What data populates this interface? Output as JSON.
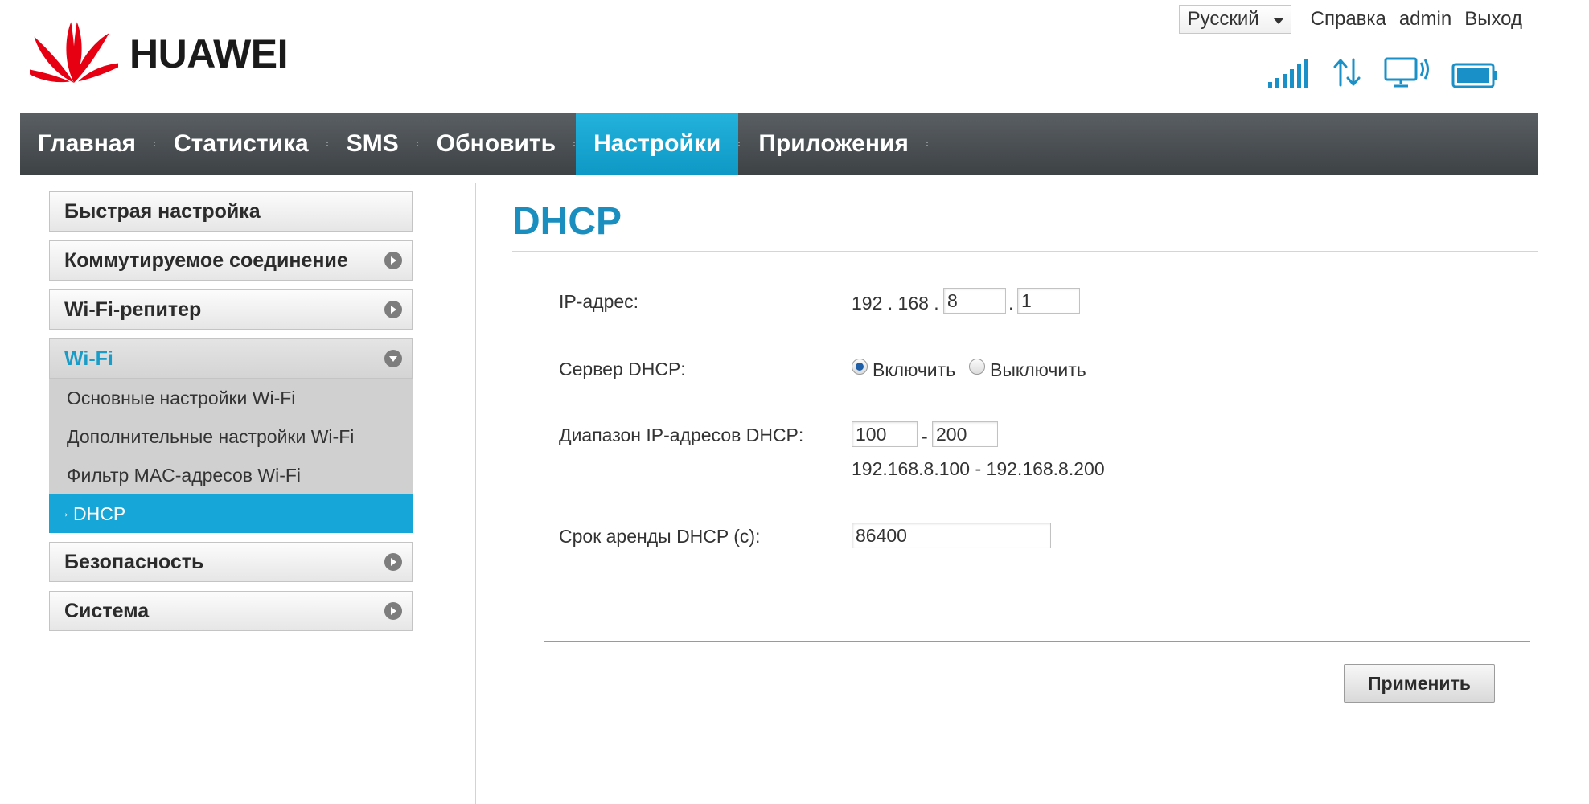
{
  "brand": {
    "name": "HUAWEI",
    "logo_color": "#e60012"
  },
  "header": {
    "language": "Русский",
    "help": "Справка",
    "user": "admin",
    "logout": "Выход",
    "status_icons": [
      "signal-strength-icon",
      "data-transfer-icon",
      "connected-device-icon",
      "battery-icon"
    ],
    "icon_color": "#1a90c8"
  },
  "nav": {
    "active_color": "#17a6d8",
    "items": [
      {
        "label": "Главная"
      },
      {
        "label": "Статистика"
      },
      {
        "label": "SMS"
      },
      {
        "label": "Обновить"
      },
      {
        "label": "Настройки",
        "active": true
      },
      {
        "label": "Приложения"
      }
    ]
  },
  "sidebar": {
    "items": [
      {
        "label": "Быстрая настройка"
      },
      {
        "label": "Коммутируемое соединение"
      },
      {
        "label": "Wi-Fi-репитер"
      },
      {
        "label": "Wi-Fi",
        "open": true,
        "children": [
          {
            "label": "Основные настройки Wi-Fi"
          },
          {
            "label": "Дополнительные настройки Wi-Fi"
          },
          {
            "label": "Фильтр MAC-адресов Wi-Fi"
          },
          {
            "label": "DHCP",
            "active": true
          }
        ]
      },
      {
        "label": "Безопасность"
      },
      {
        "label": "Система"
      }
    ]
  },
  "content": {
    "title": "DHCP",
    "ip_address": {
      "label": "IP-адрес:",
      "fixed_octets": "192 . 168 .",
      "separator": ".",
      "octet3": "8",
      "octet4": "1"
    },
    "dhcp_server": {
      "label": "Сервер DHCP:",
      "options": [
        "Включить",
        "Выключить"
      ],
      "selected": "Включить"
    },
    "dhcp_range": {
      "label": "Диапазон IP-адресов DHCP:",
      "start": "100",
      "separator": "-",
      "end": "200",
      "hint": "192.168.8.100 - 192.168.8.200"
    },
    "lease_time": {
      "label": "Срок аренды DHCP (с):",
      "value": "86400"
    },
    "apply_label": "Применить"
  }
}
